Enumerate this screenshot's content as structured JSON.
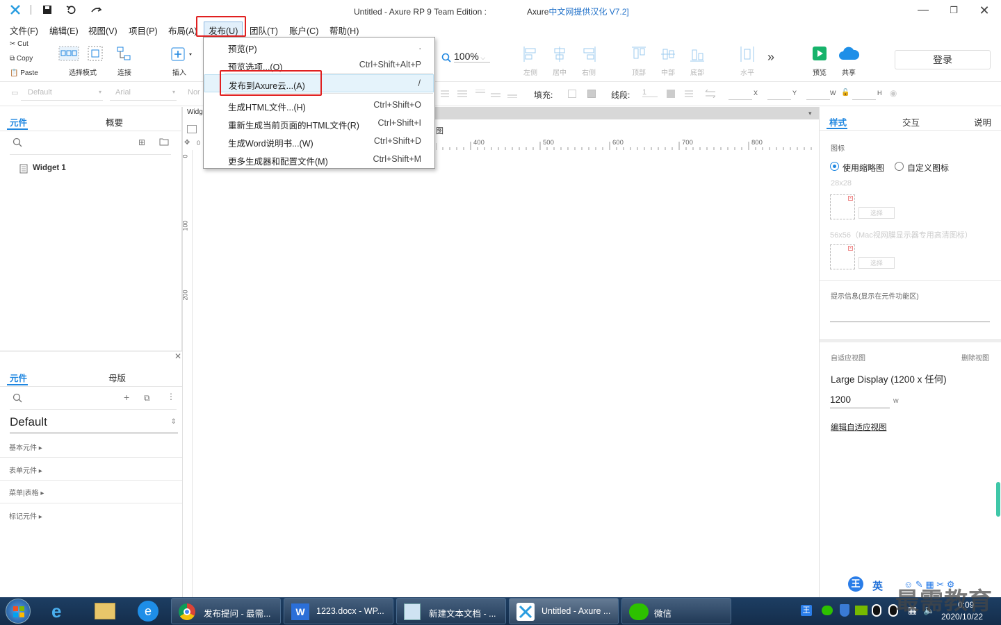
{
  "window": {
    "title_part1": "Untitled - Axure RP 9 Team Edition :",
    "title_part2": "Axure",
    "title_part3": "中文网提供汉化 V7.2]"
  },
  "menubar": [
    "文件(F)",
    "编辑(E)",
    "视图(V)",
    "项目(P)",
    "布局(A)",
    "发布(U)",
    "团队(T)",
    "账户(C)",
    "帮助(H)"
  ],
  "clipboard": {
    "cut": "Cut",
    "copy": "Copy",
    "paste": "Paste"
  },
  "toolbar": {
    "select_mode": "选择模式",
    "connect": "连接",
    "insert": "插入",
    "zoom": "100%",
    "align": [
      "左侧",
      "居中",
      "右侧",
      "顶部",
      "中部",
      "底部",
      "水平"
    ],
    "preview": "预览",
    "share": "共享",
    "login": "登录"
  },
  "formatbar": {
    "style": "Default",
    "font": "Arial",
    "weight": "Nor",
    "fill_label": "填充:",
    "stroke_label": "线段:",
    "stroke_value": "1",
    "x_label": "X",
    "y_label": "Y",
    "w_label": "W",
    "h_label": "H"
  },
  "pages_panel": {
    "tabs": [
      "元件",
      "概要"
    ],
    "items": [
      "Widget 1"
    ]
  },
  "libraries_panel": {
    "tabs": [
      "元件",
      "母版"
    ],
    "library": "Default",
    "categories": [
      "基本元件 ▸",
      "表单元件 ▸",
      "菜单|表格 ▸",
      "标记元件 ▸"
    ]
  },
  "canvas": {
    "tab_label": "Widg",
    "ruler_h": [
      "0",
      "400",
      "500",
      "600",
      "700",
      "800"
    ],
    "ruler_v": [
      "0",
      "100",
      "200"
    ],
    "partial_label": "图"
  },
  "publish_menu": {
    "items": [
      {
        "label": "预览(P)",
        "shortcut": "."
      },
      {
        "label": "预览选项...(O)",
        "shortcut": "Ctrl+Shift+Alt+P"
      },
      {
        "label": "发布到Axure云...(A)",
        "shortcut": "/"
      },
      {
        "label": "生成HTML文件...(H)",
        "shortcut": "Ctrl+Shift+O"
      },
      {
        "label": "重新生成当前页面的HTML文件(R)",
        "shortcut": "Ctrl+Shift+I"
      },
      {
        "label": "生成Word说明书...(W)",
        "shortcut": "Ctrl+Shift+D"
      },
      {
        "label": "更多生成器和配置文件(M)",
        "shortcut": "Ctrl+Shift+M"
      }
    ]
  },
  "inspector": {
    "tabs": [
      "样式",
      "交互",
      "说明"
    ],
    "icon_section": "图标",
    "radio_thumbnail": "使用缩略图",
    "radio_custom": "自定义图标",
    "size_small": "28x28",
    "size_large": "56x56（Mac视网膜显示器专用高清图标）",
    "choose": "选择",
    "tooltip_label": "提示信息(显示在元件功能区)",
    "adaptive_label": "自适应视图",
    "delete_views": "删除视图",
    "display": "Large Display (1200 x 任何)",
    "width_value": "1200",
    "width_unit": "w",
    "edit_views": "编辑自适应视图"
  },
  "taskbar": {
    "items": [
      "发布提问 - 最需...",
      "1223.docx - WP...",
      "新建文本文档 - ...",
      "Untitled - Axure ...",
      "微信"
    ],
    "time": "0:09",
    "date": "2020/10/22",
    "ime": "英"
  },
  "watermark": "最需教育",
  "colors": {
    "accent": "#1e86e0",
    "highlight_box": "#e02020",
    "taskbar": "#1d3e63"
  }
}
